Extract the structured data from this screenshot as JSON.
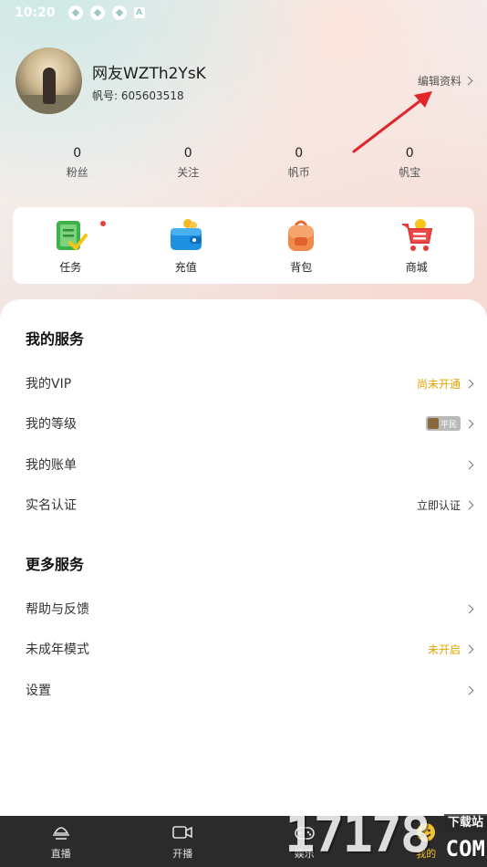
{
  "status_bar": {
    "time": "10:20"
  },
  "profile": {
    "nickname": "网友WZTh2YsK",
    "account_label": "帆号:",
    "account_id": "605603518",
    "edit_label": "编辑资料"
  },
  "stats": [
    {
      "value": "0",
      "label": "粉丝"
    },
    {
      "value": "0",
      "label": "关注"
    },
    {
      "value": "0",
      "label": "帆币"
    },
    {
      "value": "0",
      "label": "帆宝"
    }
  ],
  "quick_actions": [
    {
      "label": "任务",
      "icon": "task-clipboard-icon"
    },
    {
      "label": "充值",
      "icon": "wallet-icon"
    },
    {
      "label": "背包",
      "icon": "backpack-icon"
    },
    {
      "label": "商城",
      "icon": "shopping-cart-icon"
    }
  ],
  "my_services": {
    "title": "我的服务",
    "rows": [
      {
        "label": "我的VIP",
        "value": "尚未开通"
      },
      {
        "label": "我的等级",
        "value": "平民"
      },
      {
        "label": "我的账单",
        "value": ""
      },
      {
        "label": "实名认证",
        "value": "立即认证"
      }
    ]
  },
  "more_services": {
    "title": "更多服务",
    "rows": [
      {
        "label": "帮助与反馈",
        "value": ""
      },
      {
        "label": "未成年模式",
        "value": "未开启"
      },
      {
        "label": "设置",
        "value": ""
      }
    ]
  },
  "bottom_nav": [
    {
      "label": "直播",
      "icon": "live-icon"
    },
    {
      "label": "开播",
      "icon": "video-camera-icon"
    },
    {
      "label": "娱乐",
      "icon": "gamepad-icon"
    },
    {
      "label": "我的",
      "icon": "smiley-icon"
    }
  ],
  "watermark": {
    "number": "17178",
    "box": "下载站",
    "domain": "COM"
  },
  "colors": {
    "gold": "#e2a400",
    "nav_bg": "#2b2b2b",
    "active_nav": "#f2c230",
    "annotation_arrow": "#e0262a"
  }
}
